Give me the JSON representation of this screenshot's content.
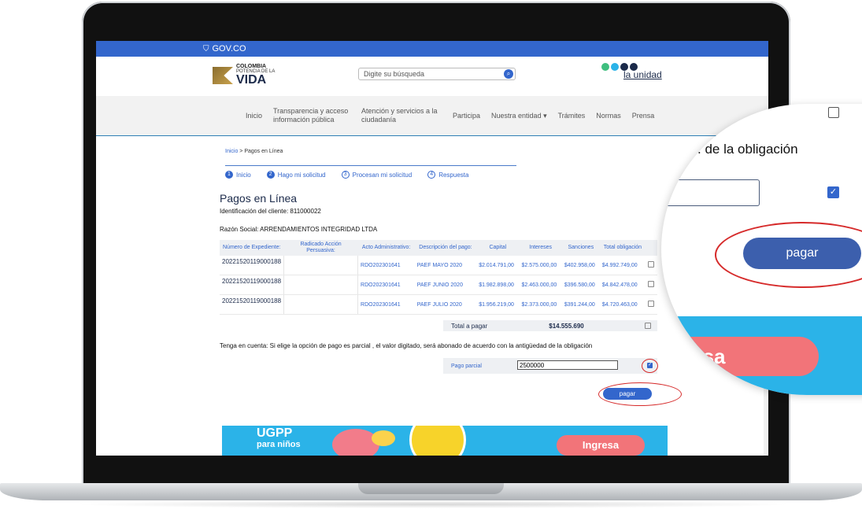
{
  "gov_bar": {
    "label": "GOV.CO"
  },
  "header": {
    "logo_left_top": "COLOMBIA",
    "logo_left_mid": "POTENCIA DE LA",
    "logo_left_main": "VIDA",
    "search_placeholder": "Digite su búsqueda",
    "logo_right": "la unidad"
  },
  "nav": {
    "items": [
      {
        "label": "Inicio"
      },
      {
        "label": "Transparencia y acceso información pública"
      },
      {
        "label": "Atención y servicios a la ciudadanía"
      },
      {
        "label": "Participa"
      },
      {
        "label": "Nuestra entidad ▾"
      },
      {
        "label": "Trámites"
      },
      {
        "label": "Normas"
      },
      {
        "label": "Prensa"
      }
    ]
  },
  "breadcrumb": {
    "home": "Inicio",
    "sep": " > ",
    "current": "Pagos en Línea"
  },
  "steps": [
    {
      "num": "1",
      "label": "Inicio"
    },
    {
      "num": "2",
      "label": "Hago mi solicitud"
    },
    {
      "num": "3",
      "label": "Procesan mi solicitud"
    },
    {
      "num": "4",
      "label": "Respuesta"
    }
  ],
  "page": {
    "title": "Pagos en Línea",
    "client_id": "Identificación del cliente: 811000022",
    "razon_social": "Razón Social: ARRENDAMIENTOS INTEGRIDAD LTDA"
  },
  "table": {
    "headers": [
      "Número de Expediente:",
      "Radicado Acción Persuasiva:",
      "Acto Administrativo:",
      "Descripción del pago:",
      "Capital",
      "Intereses",
      "Sanciones",
      "Total obligación"
    ],
    "rows": [
      {
        "exp": "20221520119000188",
        "rad": "",
        "acto": "RDO202301641",
        "desc": "PAEF MAYO 2020",
        "capital": "$2.014.791,00",
        "intereses": "$2.575.000,00",
        "sanciones": "$402.958,00",
        "total": "$4.992.749,00"
      },
      {
        "exp": "20221520119000188",
        "rad": "",
        "acto": "RDO202301641",
        "desc": "PAEF JUNIO 2020",
        "capital": "$1.982.898,00",
        "intereses": "$2.463.000,00",
        "sanciones": "$396.580,00",
        "total": "$4.842.478,00"
      },
      {
        "exp": "20221520119000188",
        "rad": "",
        "acto": "RDO202301641",
        "desc": "PAEF JULIO 2020",
        "capital": "$1.956.219,00",
        "intereses": "$2.373.000,00",
        "sanciones": "$391.244,00",
        "total": "$4.720.463,00"
      }
    ],
    "total_label": "Total a pagar",
    "total_value": "$14.555.690"
  },
  "note": "Tenga en cuenta: Si elige la opción de pago es parcial , el valor digitado, será abonado de acuerdo con la antigüedad de la obligación",
  "partial": {
    "label": "Pago parcial",
    "value": "2500000"
  },
  "pay_button": "pagar",
  "banner": {
    "title": "UGPP",
    "subtitle": "para niños",
    "cta": "Ingresa"
  },
  "magnifier": {
    "text": ". de la obligación",
    "pay_button": "pagar",
    "cta": "resa"
  },
  "colors": {
    "gov_blue": "#3366cc",
    "accent_red": "#d62b2b",
    "banner_blue": "#2bb3e8",
    "cta_pink": "#f27479"
  }
}
